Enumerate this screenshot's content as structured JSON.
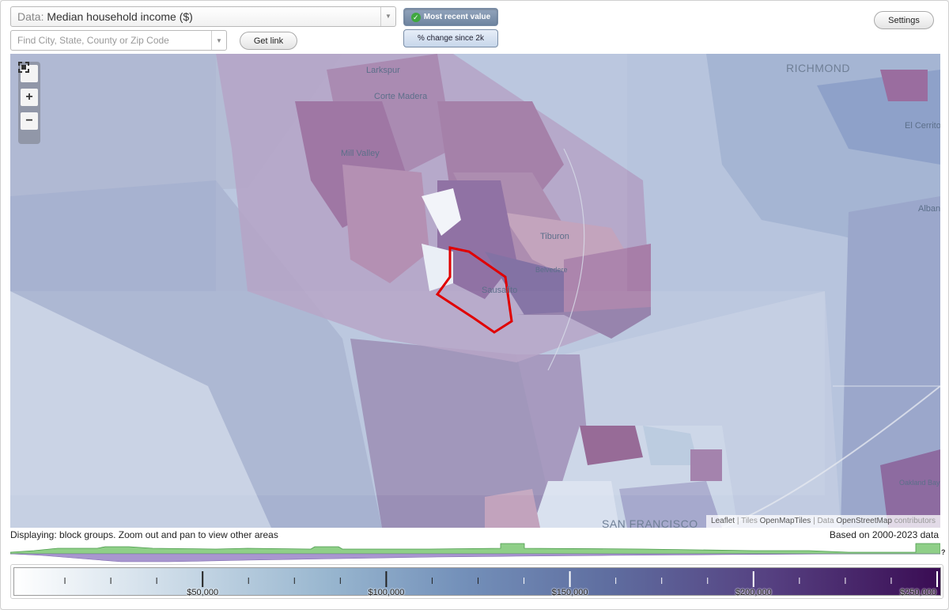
{
  "controls": {
    "data_prefix": "Data:",
    "data_value": "Median household income ($)",
    "search_placeholder": "Find City, State, County or Zip Code",
    "get_link_label": "Get link",
    "most_recent_label": "Most recent value",
    "pct_change_label": "% change since 2k",
    "settings_label": "Settings"
  },
  "map": {
    "place_labels": [
      "Larkspur",
      "Corte Madera",
      "Mill Valley",
      "Tiburon",
      "Belvedere",
      "Sausalito",
      "RICHMOND",
      "El Cerrito",
      "Albany",
      "SAN FRANCISCO",
      "Oakland Bay Bridge"
    ],
    "zoom_controls": [
      "fullscreen",
      "+",
      "−"
    ],
    "attribution": {
      "leaflet": "Leaflet",
      "sep1": "|",
      "tiles": "Tiles",
      "tiles_source": "OpenMapTiles",
      "sep2": "|",
      "data": "Data",
      "data_source": "OpenStreetMap",
      "contributors": "contributors"
    }
  },
  "info": {
    "displaying": "Displaying: block groups. Zoom out and pan to view other areas",
    "based_on": "Based on 2000-2023 data",
    "help": "?"
  },
  "legend": {
    "min": 0,
    "max": 250000,
    "labels": [
      {
        "value": 50000,
        "text": "$50,000"
      },
      {
        "value": 100000,
        "text": "$100,000"
      },
      {
        "value": 150000,
        "text": "$150,000"
      },
      {
        "value": 200000,
        "text": "$200,000"
      },
      {
        "value": 250000,
        "text": "$250,000"
      }
    ],
    "minor_step": 12500,
    "major_step": 50000
  },
  "colors": {
    "accent": "#6e84a0",
    "highlight_outline": "#e00000",
    "scale_low": "#ffffff",
    "scale_high": "#3a0c53"
  }
}
